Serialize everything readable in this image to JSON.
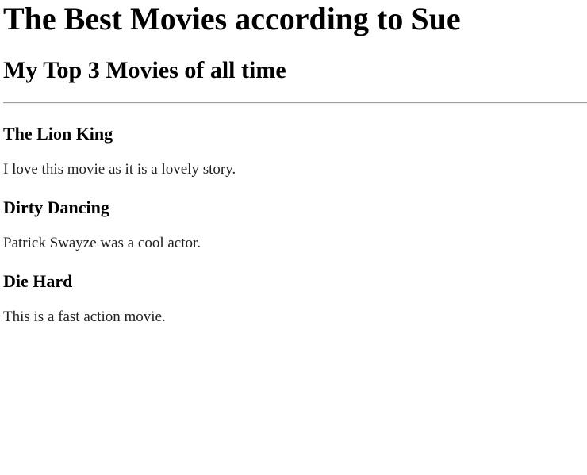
{
  "page": {
    "title": "The Best Movies according to Sue",
    "subtitle": "My Top 3 Movies of all time"
  },
  "movies": [
    {
      "title": "The Lion King",
      "description": "I love this movie as it is a lovely story."
    },
    {
      "title": "Dirty Dancing",
      "description": "Patrick Swayze was a cool actor."
    },
    {
      "title": "Die Hard",
      "description": "This is a fast action movie."
    }
  ]
}
